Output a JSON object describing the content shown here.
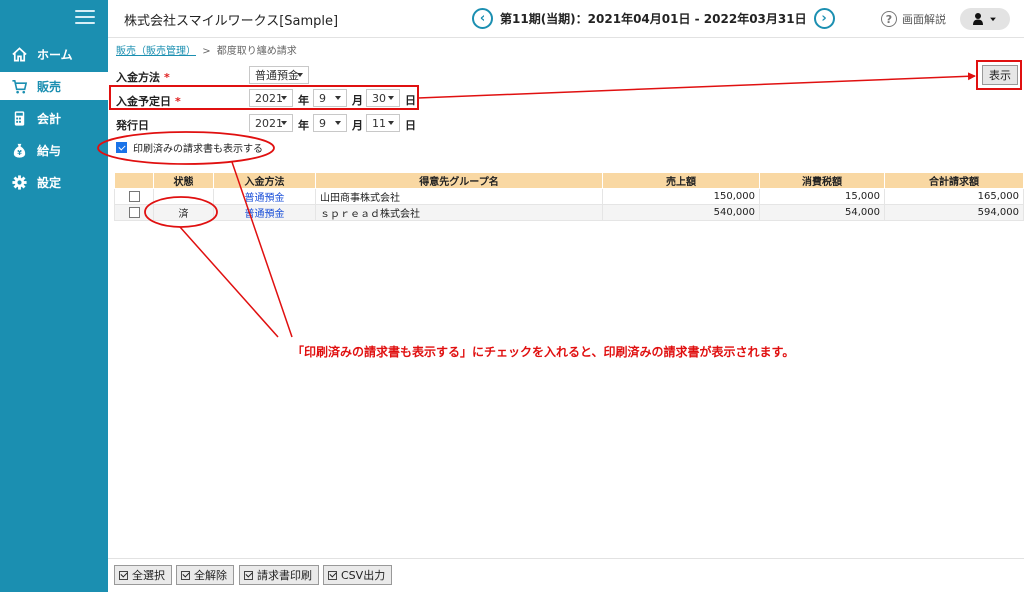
{
  "sidebar": {
    "items": [
      {
        "label": "ホーム",
        "icon": "home-icon"
      },
      {
        "label": "販売",
        "icon": "cart-icon"
      },
      {
        "label": "会計",
        "icon": "calculator-icon"
      },
      {
        "label": "給与",
        "icon": "money-bag-icon"
      },
      {
        "label": "設定",
        "icon": "gear-icon"
      }
    ],
    "active_index": 1,
    "bg_color": "#1b8fb1"
  },
  "header": {
    "company": "株式会社スマイルワークス[Sample]",
    "period": "第11期(当期)：2021年04月01日 - 2022年03月31日",
    "prev_symbol": "‹",
    "next_symbol": "›",
    "help_symbol": "?",
    "help_label": "画面解説"
  },
  "breadcrumb": {
    "parent": "販売（販売管理）",
    "separator": ">",
    "current": "都度取り纏め請求"
  },
  "form": {
    "payment_method": {
      "label": "入金方法",
      "required_mark": "*",
      "value": "普通預金"
    },
    "due_date": {
      "label": "入金予定日",
      "required_mark": "*",
      "year": "2021",
      "month": "9",
      "day": "30",
      "year_unit": "年",
      "month_unit": "月",
      "day_unit": "日"
    },
    "issue_date": {
      "label": "発行日",
      "year": "2021",
      "month": "9",
      "day": "11",
      "year_unit": "年",
      "month_unit": "月",
      "day_unit": "日"
    },
    "show_printed": {
      "label": "印刷済みの請求書も表示する",
      "checked": true
    },
    "show_button": "表示"
  },
  "table": {
    "headers": [
      "",
      "状態",
      "入金方法",
      "得意先グループ名",
      "売上額",
      "消費税額",
      "合計請求額"
    ],
    "rows": [
      {
        "checked": false,
        "status": "",
        "method": "普通預金",
        "group": "山田商事株式会社",
        "sales": "150,000",
        "tax": "15,000",
        "total": "165,000"
      },
      {
        "checked": false,
        "status": "済",
        "method": "普通預金",
        "group": "ｓｐｒｅａｄ株式会社",
        "sales": "540,000",
        "tax": "54,000",
        "total": "594,000"
      }
    ]
  },
  "bottom_buttons": [
    "全選択",
    "全解除",
    "請求書印刷",
    "CSV出力"
  ],
  "annotation": {
    "text": "「印刷済みの請求書も表示する」にチェックを入れると、印刷済みの請求書が表示されます。",
    "color": "#e01010"
  }
}
